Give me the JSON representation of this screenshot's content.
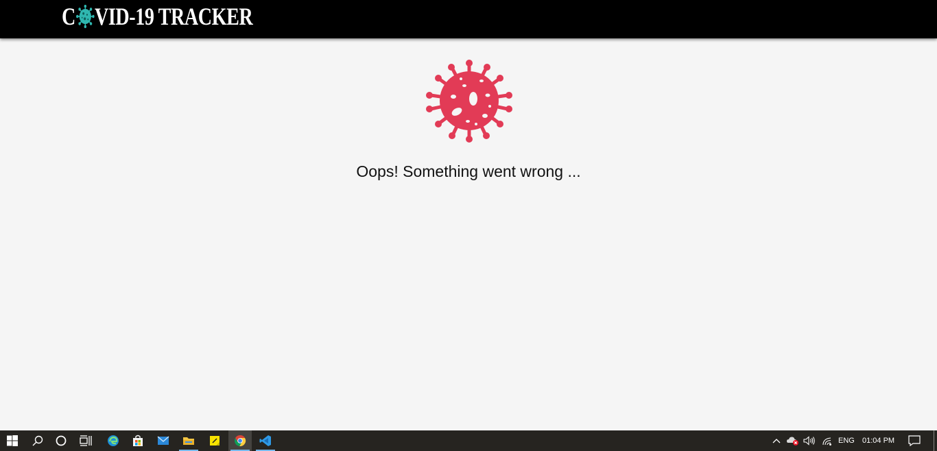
{
  "header": {
    "brand_prefix": "C",
    "brand_suffix": "VID-19 TRACKER",
    "logo_icon": "virus-icon",
    "logo_color": "#2fb7b0"
  },
  "main": {
    "illustration_icon": "virus-icon",
    "illustration_color": "#e23b56",
    "message": "Oops! Something went wrong ..."
  },
  "taskbar": {
    "pinned": [
      {
        "name": "start-button",
        "icon": "windows-icon"
      },
      {
        "name": "search-button",
        "icon": "search-icon"
      },
      {
        "name": "cortana-button",
        "icon": "cortana-icon"
      },
      {
        "name": "task-view-button",
        "icon": "task-view-icon"
      },
      {
        "name": "edge-button",
        "icon": "edge-icon"
      },
      {
        "name": "store-button",
        "icon": "store-icon"
      },
      {
        "name": "mail-button",
        "icon": "mail-icon"
      },
      {
        "name": "file-explorer-button",
        "icon": "folder-icon"
      },
      {
        "name": "sticky-notes-button",
        "icon": "sticky-notes-icon"
      },
      {
        "name": "chrome-button",
        "icon": "chrome-icon"
      },
      {
        "name": "vscode-button",
        "icon": "vscode-icon"
      }
    ],
    "tray": {
      "language": "ENG",
      "time": "01:04 PM"
    }
  }
}
